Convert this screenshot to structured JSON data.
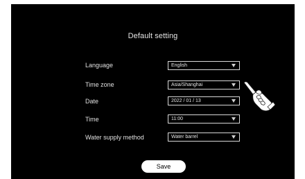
{
  "screen": {
    "title": "Default setting"
  },
  "fields": [
    {
      "label": "Language",
      "value": "English"
    },
    {
      "label": "Time zone",
      "value": "Asia/Shanghai"
    },
    {
      "label": "Date",
      "value": "2022 / 01 / 13"
    },
    {
      "label": "Time",
      "value": "11:00"
    },
    {
      "label": "Water supply method",
      "value": "Water barrel"
    }
  ],
  "actions": {
    "save_label": "Save"
  }
}
